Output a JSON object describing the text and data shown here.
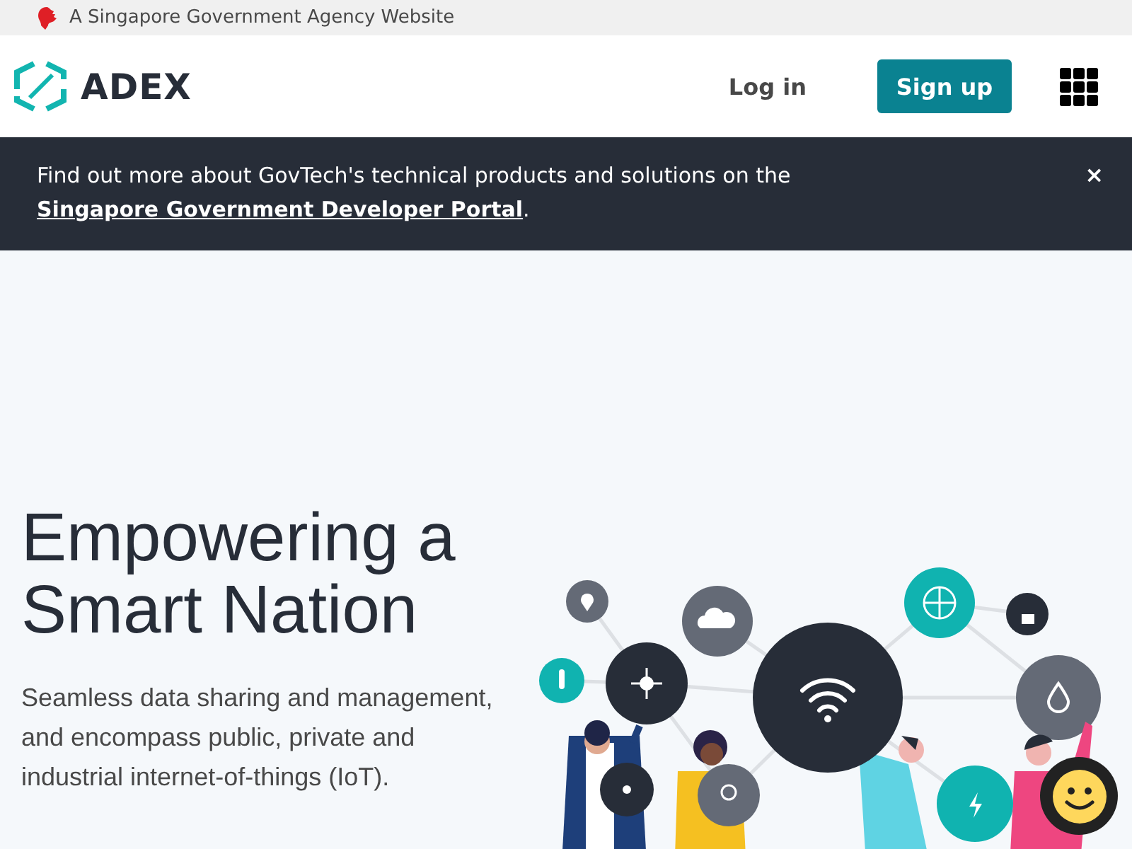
{
  "masthead": {
    "text": "A Singapore Government Agency Website"
  },
  "header": {
    "logo_text": "ADEX",
    "login": "Log in",
    "signup": "Sign up"
  },
  "banner": {
    "text_before": "Find out more about GovTech's technical products and solutions on the ",
    "link": "Singapore Government Developer Portal",
    "text_after": ".",
    "close": "×"
  },
  "hero": {
    "title": "Empowering a Smart Nation",
    "description": "Seamless data sharing and management, and encompass public, private and industrial internet-of-things (IoT)."
  }
}
